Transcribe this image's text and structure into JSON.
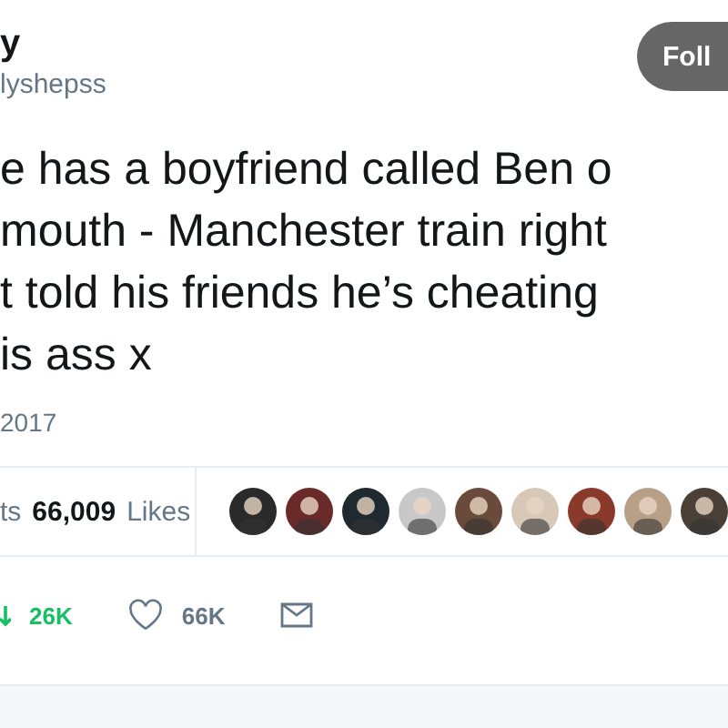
{
  "author": {
    "name": "y",
    "handle": "lyshepss"
  },
  "follow_button": {
    "label": "Foll"
  },
  "tweet": {
    "lines": [
      "e has a boyfriend called Ben o",
      "mouth - Manchester train right",
      "t told his friends he’s cheating",
      "is ass x"
    ],
    "date": "2017"
  },
  "stats": {
    "retweets_label": "ts",
    "likes_count": "66,009",
    "likes_label": "Likes"
  },
  "actions": [
    {
      "kind": "retweet",
      "count": "26K",
      "active": true
    },
    {
      "kind": "like",
      "count": "66K",
      "active": false
    },
    {
      "kind": "message"
    }
  ]
}
